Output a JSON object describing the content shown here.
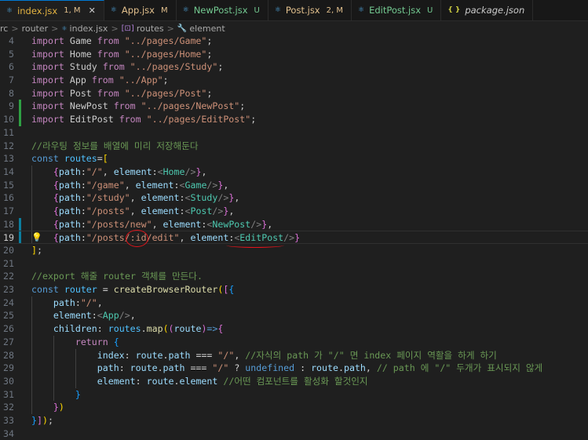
{
  "tabs": [
    {
      "name": "index.jsx",
      "status": "1, M",
      "icon": "jsx-file-icon",
      "active": true,
      "state": "mod"
    },
    {
      "name": "App.jsx",
      "status": "M",
      "icon": "jsx-file-icon",
      "active": false,
      "state": "mod"
    },
    {
      "name": "NewPost.jsx",
      "status": "U",
      "icon": "jsx-file-icon",
      "active": false,
      "state": "new"
    },
    {
      "name": "Post.jsx",
      "status": "2, M",
      "icon": "jsx-file-icon",
      "active": false,
      "state": "mod"
    },
    {
      "name": "EditPost.jsx",
      "status": "U",
      "icon": "jsx-file-icon",
      "active": false,
      "state": "new"
    },
    {
      "name": "package.json",
      "status": "",
      "icon": "json-file-icon",
      "active": false,
      "state": "ital"
    }
  ],
  "close_glyph": "✕",
  "breadcrumb": {
    "parts": [
      "rc",
      "router",
      "index.jsx",
      "routes",
      "element"
    ],
    "sep": ">"
  },
  "lines": [
    {
      "n": "4",
      "gutter": "",
      "t": [
        [
          "kw",
          "import"
        ],
        [
          "",
          " Game "
        ],
        [
          "kw",
          "from"
        ],
        [
          "",
          " "
        ],
        [
          "str",
          "\"../pages/Game\""
        ],
        [
          "",
          ";"
        ]
      ]
    },
    {
      "n": "5",
      "gutter": "",
      "t": [
        [
          "kw",
          "import"
        ],
        [
          "",
          " Home "
        ],
        [
          "kw",
          "from"
        ],
        [
          "",
          " "
        ],
        [
          "str",
          "\"../pages/Home\""
        ],
        [
          "",
          ";"
        ]
      ]
    },
    {
      "n": "6",
      "gutter": "",
      "t": [
        [
          "kw",
          "import"
        ],
        [
          "",
          " Study "
        ],
        [
          "kw",
          "from"
        ],
        [
          "",
          " "
        ],
        [
          "str",
          "\"../pages/Study\""
        ],
        [
          "",
          ";"
        ]
      ]
    },
    {
      "n": "7",
      "gutter": "",
      "t": [
        [
          "kw",
          "import"
        ],
        [
          "",
          " App "
        ],
        [
          "kw",
          "from"
        ],
        [
          "",
          " "
        ],
        [
          "str",
          "\"../App\""
        ],
        [
          "",
          ";"
        ]
      ]
    },
    {
      "n": "8",
      "gutter": "",
      "t": [
        [
          "kw",
          "import"
        ],
        [
          "",
          " Post "
        ],
        [
          "kw",
          "from"
        ],
        [
          "",
          " "
        ],
        [
          "str",
          "\"../pages/Post\""
        ],
        [
          "",
          ";"
        ]
      ]
    },
    {
      "n": "9",
      "gutter": "add",
      "t": [
        [
          "kw",
          "import"
        ],
        [
          "",
          " NewPost "
        ],
        [
          "kw",
          "from"
        ],
        [
          "",
          " "
        ],
        [
          "str",
          "\"../pages/NewPost\""
        ],
        [
          "",
          ";"
        ]
      ]
    },
    {
      "n": "10",
      "gutter": "add",
      "t": [
        [
          "kw",
          "import"
        ],
        [
          "",
          " EditPost "
        ],
        [
          "kw",
          "from"
        ],
        [
          "",
          " "
        ],
        [
          "str",
          "\"../pages/EditPost\""
        ],
        [
          "",
          ";"
        ]
      ]
    },
    {
      "n": "11",
      "gutter": "",
      "t": []
    },
    {
      "n": "12",
      "gutter": "",
      "t": [
        [
          "cm",
          "//라우팅 정보를 배열에 미리 저장해둔다"
        ]
      ]
    },
    {
      "n": "13",
      "gutter": "",
      "t": [
        [
          "kb",
          "const"
        ],
        [
          "",
          " "
        ],
        [
          "cn",
          "routes"
        ],
        [
          "op",
          "="
        ],
        [
          "br1",
          "["
        ]
      ]
    },
    {
      "n": "14",
      "gutter": "",
      "t": [
        [
          "",
          "    "
        ],
        [
          "br2",
          "{"
        ],
        [
          "id",
          "path"
        ],
        [
          "op",
          ":"
        ],
        [
          "str",
          "\"/\""
        ],
        [
          "",
          ", "
        ],
        [
          "id",
          "element"
        ],
        [
          "op",
          ":"
        ],
        [
          "pn",
          "<"
        ],
        [
          "tg",
          "Home"
        ],
        [
          "pn",
          "/>"
        ],
        [
          "br2",
          "}"
        ],
        [
          "",
          ","
        ]
      ]
    },
    {
      "n": "15",
      "gutter": "",
      "t": [
        [
          "",
          "    "
        ],
        [
          "br2",
          "{"
        ],
        [
          "id",
          "path"
        ],
        [
          "op",
          ":"
        ],
        [
          "str",
          "\"/game\""
        ],
        [
          "",
          ", "
        ],
        [
          "id",
          "element"
        ],
        [
          "op",
          ":"
        ],
        [
          "pn",
          "<"
        ],
        [
          "tg",
          "Game"
        ],
        [
          "pn",
          "/>"
        ],
        [
          "br2",
          "}"
        ],
        [
          "",
          ","
        ]
      ]
    },
    {
      "n": "16",
      "gutter": "",
      "t": [
        [
          "",
          "    "
        ],
        [
          "br2",
          "{"
        ],
        [
          "id",
          "path"
        ],
        [
          "op",
          ":"
        ],
        [
          "str",
          "\"/study\""
        ],
        [
          "",
          ", "
        ],
        [
          "id",
          "element"
        ],
        [
          "op",
          ":"
        ],
        [
          "pn",
          "<"
        ],
        [
          "tg",
          "Study"
        ],
        [
          "pn",
          "/>"
        ],
        [
          "br2",
          "}"
        ],
        [
          "",
          ","
        ]
      ]
    },
    {
      "n": "17",
      "gutter": "",
      "t": [
        [
          "",
          "    "
        ],
        [
          "br2",
          "{"
        ],
        [
          "id",
          "path"
        ],
        [
          "op",
          ":"
        ],
        [
          "str",
          "\"/posts\""
        ],
        [
          "",
          ", "
        ],
        [
          "id",
          "element"
        ],
        [
          "op",
          ":"
        ],
        [
          "pn",
          "<"
        ],
        [
          "tg",
          "Post"
        ],
        [
          "pn",
          "/>"
        ],
        [
          "br2",
          "}"
        ],
        [
          "",
          ","
        ]
      ]
    },
    {
      "n": "18",
      "gutter": "mod",
      "t": [
        [
          "",
          "    "
        ],
        [
          "br2",
          "{"
        ],
        [
          "id",
          "path"
        ],
        [
          "op",
          ":"
        ],
        [
          "str",
          "\"/posts/new\""
        ],
        [
          "",
          ", "
        ],
        [
          "id",
          "element"
        ],
        [
          "op",
          ":"
        ],
        [
          "pn",
          "<"
        ],
        [
          "tg",
          "NewPost"
        ],
        [
          "pn",
          "/>"
        ],
        [
          "br2",
          "}"
        ],
        [
          "",
          ","
        ]
      ]
    },
    {
      "n": "19",
      "gutter": "mod",
      "bulb": true,
      "current": true,
      "t": [
        [
          "",
          "    "
        ],
        [
          "br2",
          "{"
        ],
        [
          "id",
          "path"
        ],
        [
          "op",
          ":"
        ],
        [
          "str",
          "\"/posts/:id/edit\""
        ],
        [
          "",
          ", "
        ],
        [
          "id",
          "element"
        ],
        [
          "op",
          ":"
        ],
        [
          "pn",
          "<"
        ],
        [
          "tg",
          "EditPost"
        ],
        [
          "pn",
          "/>"
        ],
        [
          "br2",
          "}"
        ]
      ]
    },
    {
      "n": "20",
      "gutter": "",
      "t": [
        [
          "br1",
          "]"
        ],
        [
          "",
          ";"
        ]
      ]
    },
    {
      "n": "21",
      "gutter": "",
      "t": []
    },
    {
      "n": "22",
      "gutter": "",
      "t": [
        [
          "cm",
          "//export 해줄 router 객체를 만든다."
        ]
      ]
    },
    {
      "n": "23",
      "gutter": "",
      "t": [
        [
          "kb",
          "const"
        ],
        [
          "",
          " "
        ],
        [
          "cn",
          "router"
        ],
        [
          "",
          " "
        ],
        [
          "op",
          "="
        ],
        [
          "",
          " "
        ],
        [
          "fn",
          "createBrowserRouter"
        ],
        [
          "br1",
          "("
        ],
        [
          "br2",
          "["
        ],
        [
          "br3",
          "{"
        ]
      ]
    },
    {
      "n": "24",
      "gutter": "",
      "t": [
        [
          "",
          "    "
        ],
        [
          "id",
          "path"
        ],
        [
          "op",
          ":"
        ],
        [
          "str",
          "\"/\""
        ],
        [
          "",
          ","
        ]
      ]
    },
    {
      "n": "25",
      "gutter": "",
      "t": [
        [
          "",
          "    "
        ],
        [
          "id",
          "element"
        ],
        [
          "op",
          ":"
        ],
        [
          "pn",
          "<"
        ],
        [
          "tg",
          "App"
        ],
        [
          "pn",
          "/>"
        ],
        [
          "",
          ","
        ]
      ]
    },
    {
      "n": "26",
      "gutter": "",
      "t": [
        [
          "",
          "    "
        ],
        [
          "id",
          "children"
        ],
        [
          "op",
          ":"
        ],
        [
          "",
          " "
        ],
        [
          "cn",
          "routes"
        ],
        [
          "op",
          "."
        ],
        [
          "fn",
          "map"
        ],
        [
          "br1",
          "("
        ],
        [
          "br2",
          "("
        ],
        [
          "id",
          "route"
        ],
        [
          "br2",
          ")"
        ],
        [
          "kb",
          "=>"
        ],
        [
          "br2",
          "{"
        ]
      ]
    },
    {
      "n": "27",
      "gutter": "",
      "t": [
        [
          "",
          "        "
        ],
        [
          "kw",
          "return"
        ],
        [
          "",
          " "
        ],
        [
          "br3",
          "{"
        ]
      ]
    },
    {
      "n": "28",
      "gutter": "",
      "t": [
        [
          "",
          "            "
        ],
        [
          "id",
          "index"
        ],
        [
          "op",
          ":"
        ],
        [
          "",
          " "
        ],
        [
          "id",
          "route"
        ],
        [
          "op",
          "."
        ],
        [
          "id",
          "path"
        ],
        [
          "",
          " "
        ],
        [
          "op",
          "==="
        ],
        [
          "",
          " "
        ],
        [
          "str",
          "\"/\""
        ],
        [
          "",
          ", "
        ],
        [
          "cm",
          "//자식의 path 가 \"/\" 면 index 페이지 역활을 하게 하기"
        ]
      ]
    },
    {
      "n": "29",
      "gutter": "",
      "t": [
        [
          "",
          "            "
        ],
        [
          "id",
          "path"
        ],
        [
          "op",
          ":"
        ],
        [
          "",
          " "
        ],
        [
          "id",
          "route"
        ],
        [
          "op",
          "."
        ],
        [
          "id",
          "path"
        ],
        [
          "",
          " "
        ],
        [
          "op",
          "==="
        ],
        [
          "",
          " "
        ],
        [
          "str",
          "\"/\""
        ],
        [
          "",
          " "
        ],
        [
          "op",
          "?"
        ],
        [
          "",
          " "
        ],
        [
          "kb",
          "undefined"
        ],
        [
          "",
          " "
        ],
        [
          "op",
          ":"
        ],
        [
          "",
          " "
        ],
        [
          "id",
          "route"
        ],
        [
          "op",
          "."
        ],
        [
          "id",
          "path"
        ],
        [
          "",
          ", "
        ],
        [
          "cm",
          "// path 에 \"/\" 두개가 표시되지 않게"
        ]
      ]
    },
    {
      "n": "30",
      "gutter": "",
      "t": [
        [
          "",
          "            "
        ],
        [
          "id",
          "element"
        ],
        [
          "op",
          ":"
        ],
        [
          "",
          " "
        ],
        [
          "id",
          "route"
        ],
        [
          "op",
          "."
        ],
        [
          "id",
          "element"
        ],
        [
          "",
          " "
        ],
        [
          "cm",
          "//어떤 컴포넌트를 활성화 할것인지"
        ]
      ]
    },
    {
      "n": "31",
      "gutter": "",
      "t": [
        [
          "",
          "        "
        ],
        [
          "br3",
          "}"
        ]
      ]
    },
    {
      "n": "32",
      "gutter": "",
      "t": [
        [
          "",
          "    "
        ],
        [
          "br2",
          "}"
        ],
        [
          "br1",
          ")"
        ]
      ]
    },
    {
      "n": "33",
      "gutter": "",
      "t": [
        [
          "br3",
          "}"
        ],
        [
          "br2",
          "]"
        ],
        [
          "br1",
          ")"
        ],
        [
          "",
          ";"
        ]
      ]
    },
    {
      "n": "34",
      "gutter": "",
      "t": []
    }
  ]
}
